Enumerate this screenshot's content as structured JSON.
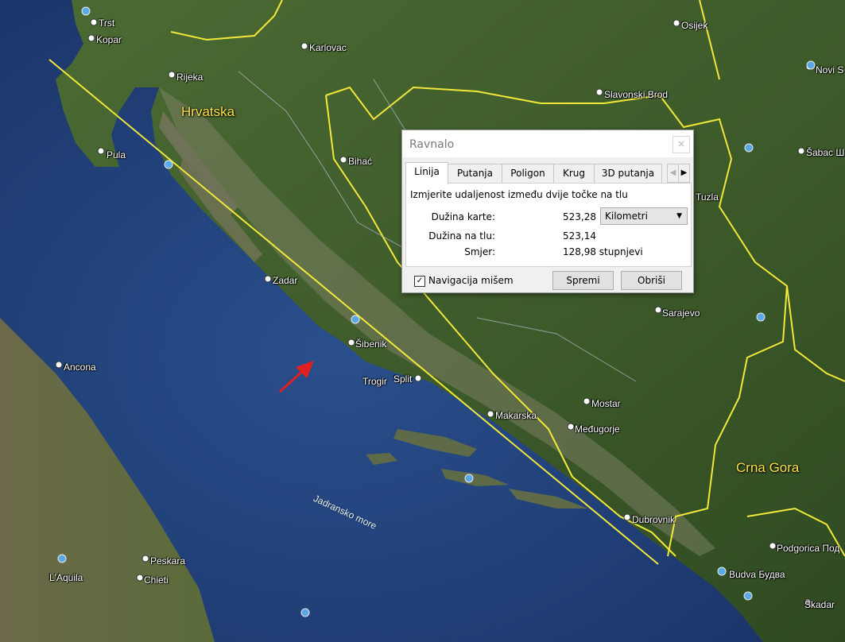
{
  "map": {
    "cities": [
      {
        "name": "Trst"
      },
      {
        "name": "Kopar"
      },
      {
        "name": "Karlovac"
      },
      {
        "name": "Rijeka"
      },
      {
        "name": "Pula"
      },
      {
        "name": "Bihać"
      },
      {
        "name": "Zadar"
      },
      {
        "name": "Šibenik"
      },
      {
        "name": "Trogir"
      },
      {
        "name": "Split"
      },
      {
        "name": "Makarska"
      },
      {
        "name": "Mostar"
      },
      {
        "name": "Međugorje"
      },
      {
        "name": "Dubrovnik"
      },
      {
        "name": "Sarajevo"
      },
      {
        "name": "Tuzla"
      },
      {
        "name": "Osijek"
      },
      {
        "name": "Slavonski Brod"
      },
      {
        "name": "Novi S"
      },
      {
        "name": "Šabac Ш"
      },
      {
        "name": "Ancona"
      },
      {
        "name": "Peskara"
      },
      {
        "name": "Chieti"
      },
      {
        "name": "L'Aquila"
      },
      {
        "name": "Podgorica Под"
      },
      {
        "name": "Budva Будва"
      },
      {
        "name": "Skadar"
      }
    ],
    "countries": [
      {
        "name": "Hrvatska"
      },
      {
        "name": "Crna Gora"
      }
    ],
    "sea_label": "Jadransko more",
    "colors": {
      "sea": "#1f3e7a",
      "land": "#3c5a28",
      "border": "#f2e83a",
      "ruler": "#f2e83a",
      "arrow": "#e02020"
    }
  },
  "dialog": {
    "title": "Ravnalo",
    "close": "×",
    "tabs": [
      {
        "label": "Linija",
        "active": true
      },
      {
        "label": "Putanja"
      },
      {
        "label": "Poligon"
      },
      {
        "label": "Krug"
      },
      {
        "label": "3D putanja"
      }
    ],
    "scroll_left": "◀",
    "scroll_right": "▶",
    "description": "Izmjerite udaljenost između dvije točke na tlu",
    "map_length_label": "Dužina karte:",
    "map_length_value": "523,28",
    "unit": "Kilometri",
    "ground_length_label": "Dužina na tlu:",
    "ground_length_value": "523,14",
    "heading_label": "Smjer:",
    "heading_value": "128,98 stupnjevi",
    "mouse_nav_label": "Navigacija mišem",
    "mouse_nav_checked": true,
    "save_button": "Spremi",
    "clear_button": "Obriši"
  }
}
